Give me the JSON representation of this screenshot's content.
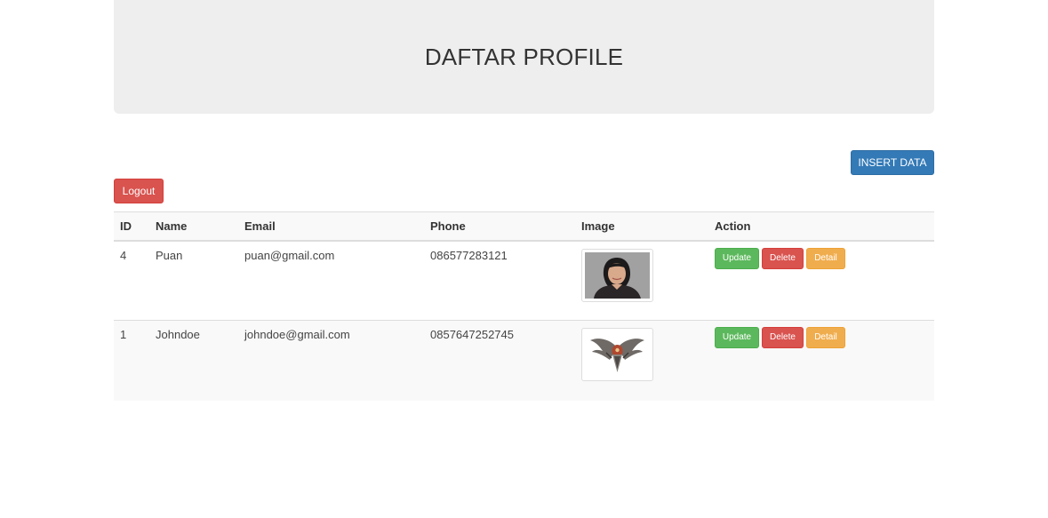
{
  "header": {
    "title": "DAFTAR PROFILE"
  },
  "toolbar": {
    "insert_label": "INSERT DATA",
    "logout_label": "Logout"
  },
  "table": {
    "columns": [
      "ID",
      "Name",
      "Email",
      "Phone",
      "Image",
      "Action"
    ],
    "rows": [
      {
        "id": "4",
        "name": "Puan",
        "email": "puan@gmail.com",
        "phone": "086577283121",
        "image": "portrait-photo"
      },
      {
        "id": "1",
        "name": "Johndoe",
        "email": "johndoe@gmail.com",
        "phone": "0857647252745",
        "image": "winged-emblem"
      }
    ],
    "actions": {
      "update": "Update",
      "delete": "Delete",
      "detail": "Detail"
    }
  },
  "colors": {
    "primary": "#337ab7",
    "success": "#5cb85c",
    "danger": "#d9534f",
    "warning": "#f0ad4e",
    "jumbotron": "#eeeeee"
  }
}
